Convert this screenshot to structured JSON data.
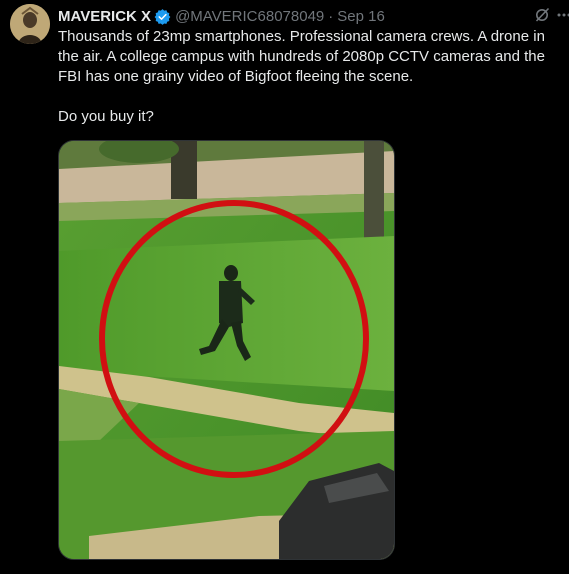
{
  "tweet": {
    "author_name": "MAVERICK X",
    "handle": "@MAVERIC68078049",
    "separator": "·",
    "date": "Sep 16",
    "verified": true,
    "verified_color": "#1d9bf0",
    "text_paragraph_1": "Thousands of 23mp smartphones. Professional camera crews. A drone in the air. A college campus with hundreds of 2080p CCTV cameras and the FBI has one grainy video of Bigfoot fleeing the scene.",
    "text_paragraph_2": "Do you buy it?",
    "icons": {
      "grok": "grok-icon",
      "more": "more-options-icon",
      "verified": "verified-badge-icon"
    }
  },
  "media": {
    "description_icon": "video-still",
    "circle_color": "#d10f12"
  },
  "theme": {
    "background": "#000000",
    "text_primary": "#e7e9ea",
    "text_secondary": "#71767b"
  }
}
